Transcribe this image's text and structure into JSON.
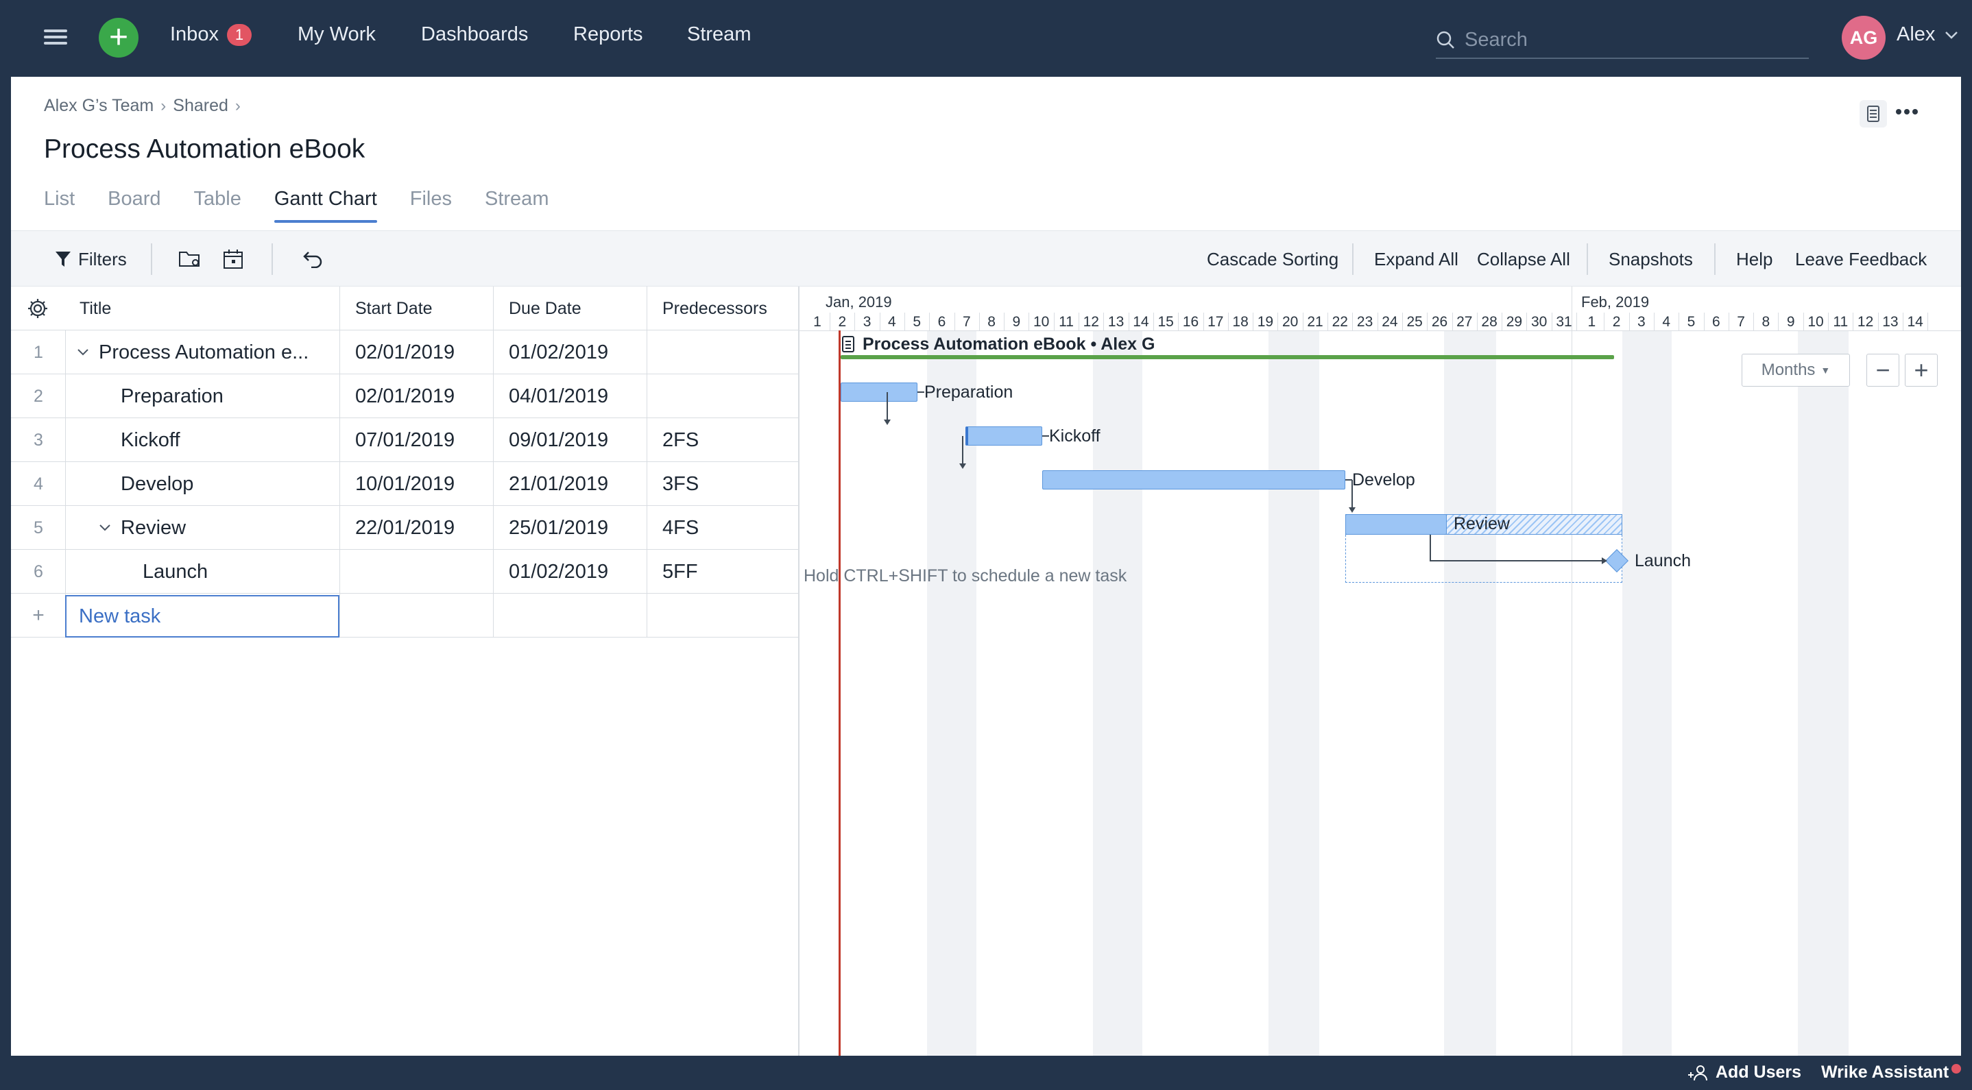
{
  "nav": {
    "inbox": "Inbox",
    "inbox_count": "1",
    "my_work": "My Work",
    "dashboards": "Dashboards",
    "reports": "Reports",
    "stream": "Stream",
    "search_placeholder": "Search",
    "user_initials": "AG",
    "user_name": "Alex"
  },
  "breadcrumb": [
    "Alex G’s Team",
    "Shared"
  ],
  "page_title": "Process Automation eBook",
  "tabs": [
    "List",
    "Board",
    "Table",
    "Gantt Chart",
    "Files",
    "Stream"
  ],
  "active_tab": "Gantt Chart",
  "toolbar": {
    "filters": "Filters",
    "cascade_sorting": "Cascade Sorting",
    "expand_all": "Expand All",
    "collapse_all": "Collapse All",
    "snapshots": "Snapshots",
    "help": "Help",
    "leave_feedback": "Leave Feedback"
  },
  "grid": {
    "columns": [
      "Title",
      "Start Date",
      "Due Date",
      "Predecessors"
    ],
    "rows": [
      {
        "num": "1",
        "title": "Process Automation e...",
        "start": "02/01/2019",
        "due": "01/02/2019",
        "pred": ""
      },
      {
        "num": "2",
        "title": "Preparation",
        "start": "02/01/2019",
        "due": "04/01/2019",
        "pred": ""
      },
      {
        "num": "3",
        "title": "Kickoff",
        "start": "07/01/2019",
        "due": "09/01/2019",
        "pred": "2FS"
      },
      {
        "num": "4",
        "title": "Develop",
        "start": "10/01/2019",
        "due": "21/01/2019",
        "pred": "3FS"
      },
      {
        "num": "5",
        "title": "Review",
        "start": "22/01/2019",
        "due": "25/01/2019",
        "pred": "4FS"
      },
      {
        "num": "6",
        "title": "Launch",
        "start": "",
        "due": "01/02/2019",
        "pred": "5FF"
      }
    ],
    "new_task_plus": "+",
    "new_task": "New task"
  },
  "gantt": {
    "months": [
      "Jan, 2019",
      "Feb, 2019"
    ],
    "jan_days": [
      "1",
      "2",
      "3",
      "4",
      "5",
      "6",
      "7",
      "8",
      "9",
      "10",
      "11",
      "12",
      "13",
      "14",
      "15",
      "16",
      "17",
      "18",
      "19",
      "20",
      "21",
      "22",
      "23",
      "24",
      "25",
      "26",
      "27",
      "28",
      "29",
      "30",
      "31"
    ],
    "feb_days": [
      "1",
      "2",
      "3",
      "4",
      "5",
      "6",
      "7",
      "8",
      "9",
      "10",
      "11",
      "12",
      "13",
      "14"
    ],
    "project_label": "Process Automation eBook • Alex G",
    "labels": {
      "preparation": "Preparation",
      "kickoff": "Kickoff",
      "develop": "Develop",
      "review": "Review",
      "launch": "Launch"
    },
    "hint": "Hold CTRL+SHIFT to schedule a new task",
    "scale": "Months",
    "colors": {
      "bar": "#9cc5f5",
      "bar_border": "#5b96dc",
      "project": "#5aa249",
      "today": "#c0392b"
    }
  },
  "footer": {
    "add_users": "Add Users",
    "assistant": "Wrike Assistant"
  }
}
